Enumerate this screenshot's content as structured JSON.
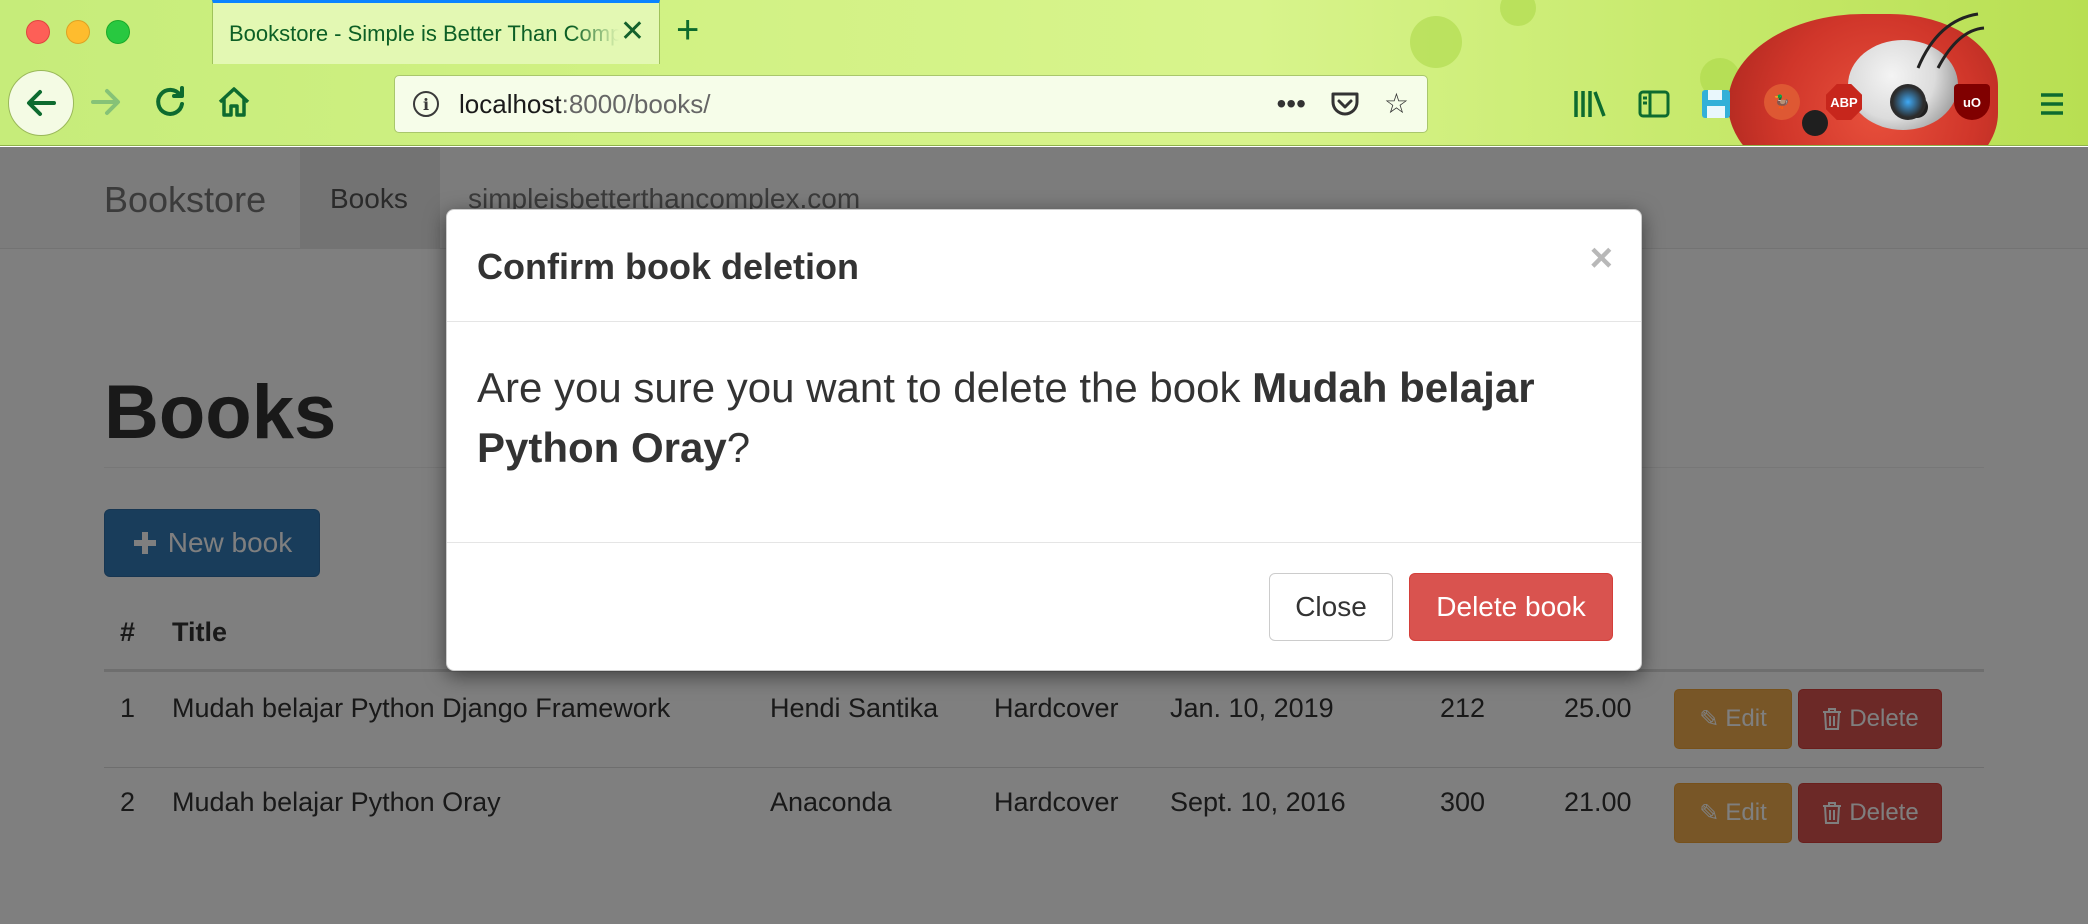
{
  "browser": {
    "tab_title": "Bookstore - Simple is Better Than Complex",
    "tab_close_icon": "close-icon",
    "new_tab_label": "+",
    "url_host": "localhost",
    "url_rest": ":8000/books/",
    "icons": [
      "back-arrow-icon",
      "forward-arrow-icon",
      "reload-icon",
      "home-icon",
      "info-icon",
      "more-icon",
      "pocket-icon",
      "bookmark-star-icon",
      "library-icon",
      "sidebar-icon",
      "save-icon",
      "duckduckgo-icon",
      "adblock-icon",
      "lens-icon",
      "ublock-icon",
      "hamburger-menu-icon"
    ],
    "abp_label": "ABP",
    "ublock_label": "uO"
  },
  "navbar": {
    "brand": "Bookstore",
    "items": [
      {
        "label": "Books",
        "active": true
      },
      {
        "label": "simpleisbetterthancomplex.com",
        "active": false
      }
    ]
  },
  "main": {
    "title": "Books",
    "new_button_label": "New book",
    "columns": [
      "#",
      "Title"
    ],
    "rows": [
      {
        "num": "1",
        "title": "Mudah belajar Python Django Framework",
        "author": "Hendi Santika",
        "type": "Hardcover",
        "date": "Jan. 10, 2019",
        "pages": "212",
        "price": "25.00"
      },
      {
        "num": "2",
        "title": "Mudah belajar Python Oray",
        "author": "Anaconda",
        "type": "Hardcover",
        "date": "Sept. 10, 2016",
        "pages": "300",
        "price": "21.00"
      }
    ],
    "edit_label": "Edit",
    "delete_label": "Delete"
  },
  "modal": {
    "title": "Confirm book deletion",
    "close_symbol": "×",
    "body_prefix": "Are you sure you want to delete the book ",
    "body_book": "Mudah belajar Python Oray",
    "body_suffix": "?",
    "close_button": "Close",
    "delete_button": "Delete book"
  },
  "colors": {
    "primary": "#337ab7",
    "warning": "#f0ad4e",
    "danger": "#d9534f"
  }
}
